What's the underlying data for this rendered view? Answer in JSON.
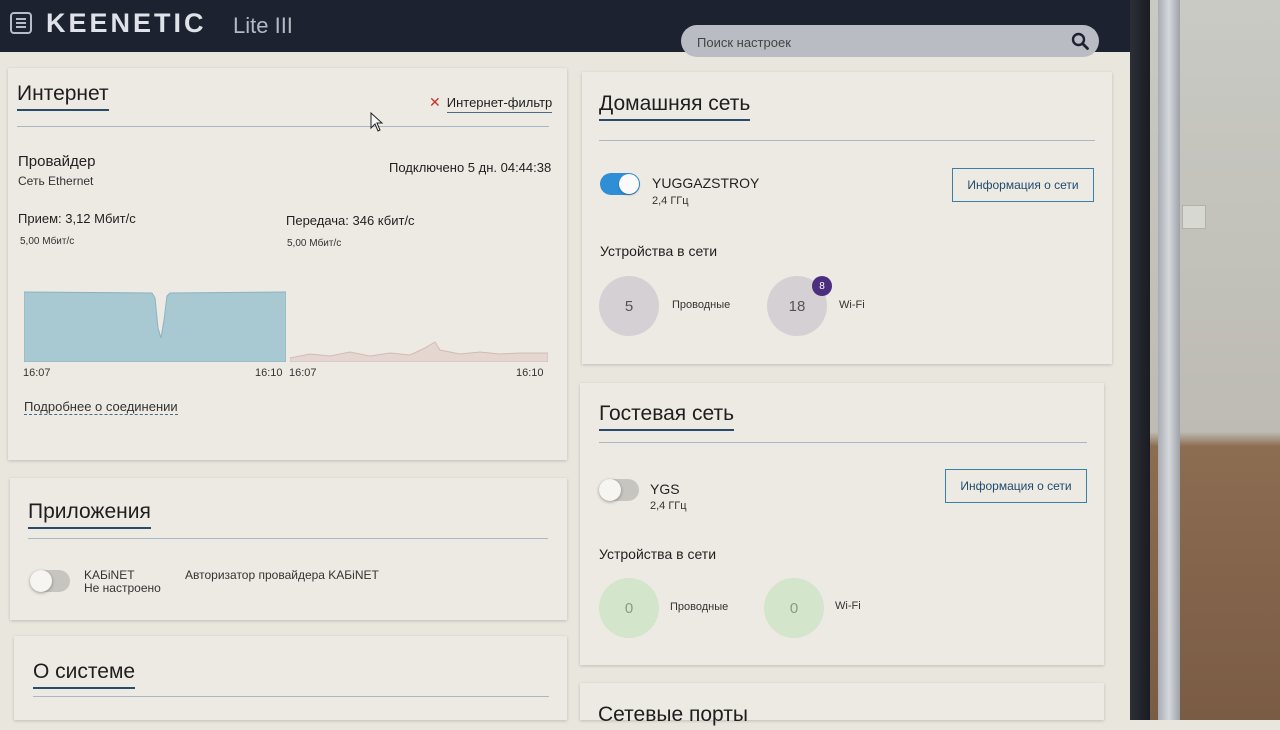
{
  "header": {
    "brand": "KEENETIC",
    "model": "Lite III",
    "search_placeholder": "Поиск настроек"
  },
  "internet": {
    "title": "Интернет",
    "filter_label": "Интернет-фильтр",
    "provider_label": "Провайдер",
    "provider_type": "Сеть Ethernet",
    "connected": "Подключено 5 дн. 04:44:38",
    "rx_label": "Прием: 3,12 Мбит/с",
    "rx_scale": "5,00 Мбит/с",
    "tx_label": "Передача: 346 кбит/с",
    "tx_scale": "5,00 Мбит/с",
    "rx_time_start": "16:07",
    "rx_time_end": "16:10",
    "tx_time_start": "16:07",
    "tx_time_end": "16:10",
    "details_link": "Подробнее о соединении"
  },
  "apps": {
    "title": "Приложения",
    "app_name": "KAБiNET",
    "app_status": "Не настроено",
    "app_desc": "Авторизатор провайдера KAБiNET"
  },
  "system": {
    "title": "О системе"
  },
  "home": {
    "title": "Домашняя сеть",
    "ssid": "YUGGAZSTROY",
    "band": "2,4 ГГц",
    "enabled": true,
    "info_button": "Информация о сети",
    "devices_label": "Устройства в сети",
    "wired_count": "5",
    "wired_label": "Проводные",
    "wifi_count": "18",
    "wifi_badge": "8",
    "wifi_label": "Wi-Fi"
  },
  "guest": {
    "title": "Гостевая сеть",
    "ssid": "YGS",
    "band": "2,4 ГГц",
    "enabled": false,
    "info_button": "Информация о сети",
    "devices_label": "Устройства в сети",
    "wired_count": "0",
    "wired_label": "Проводные",
    "wifi_count": "0",
    "wifi_label": "Wi-Fi"
  },
  "ports": {
    "title": "Сетевые порты"
  },
  "colors": {
    "accent": "#2f8fd6",
    "header_bg": "#1d2230",
    "filter_off": "#c8332b",
    "badge": "#4b2f7e"
  }
}
